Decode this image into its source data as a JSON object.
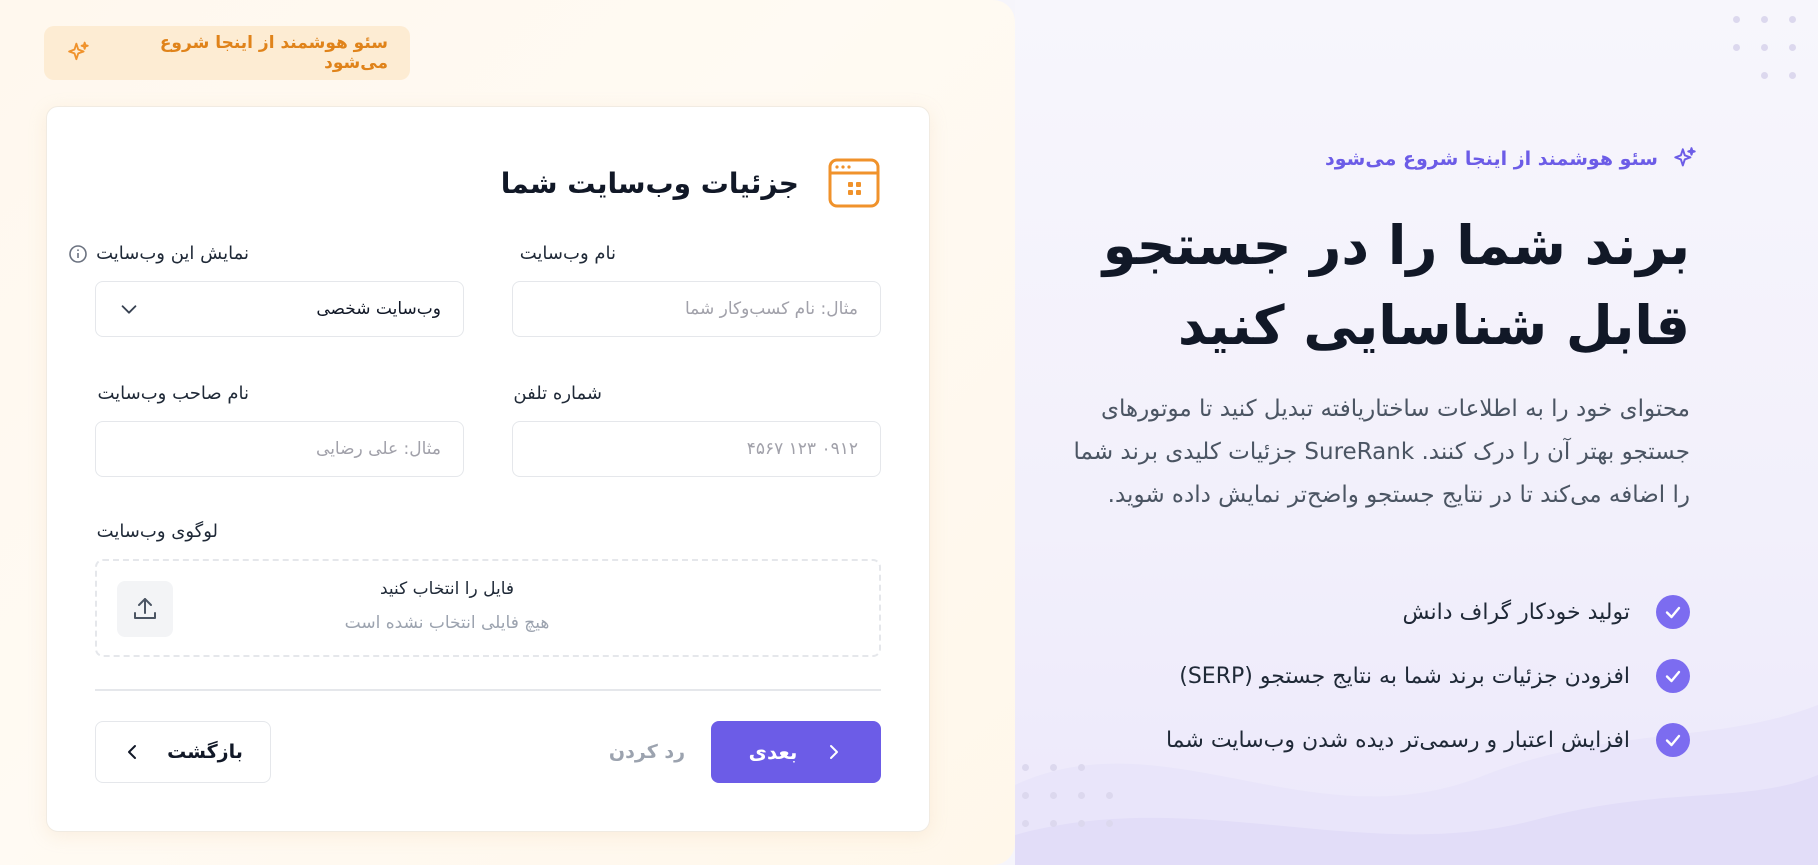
{
  "top_badge": {
    "text": "سئو هوشمند از اینجا شروع می‌شود",
    "icon": "sparkle-icon"
  },
  "card": {
    "title": "جزئیات وب‌سایت شما",
    "fields": {
      "website_name": {
        "label": "نام وب‌سایت",
        "placeholder": "مثال: نام کسب‌وکار شما"
      },
      "website_type": {
        "label": "نمایش این وب‌سایت",
        "value": "وب‌سایت شخصی"
      },
      "phone": {
        "label": "شماره تلفن",
        "placeholder": "۰۹۱۲ ۱۲۳ ۴۵۶۷"
      },
      "owner_name": {
        "label": "نام صاحب وب‌سایت",
        "placeholder": "مثال: علی رضایی"
      },
      "logo": {
        "label": "لوگوی وب‌سایت",
        "choose_text": "فایل را انتخاب کنید",
        "no_file_text": "هیچ فایلی انتخاب نشده است"
      }
    },
    "buttons": {
      "back": "بازگشت",
      "skip": "رد کردن",
      "next": "بعدی"
    }
  },
  "hero": {
    "badge": "سئو هوشمند از اینجا شروع می‌شود",
    "title_line1": "برند شما را در جستجو",
    "title_line2": "قابل شناسایی کنید",
    "description": "محتوای خود را به اطلاعات ساختاریافته تبدیل کنید تا موتورهای جستجو بهتر آن را درک کنند. SureRank جزئیات کلیدی برند شما را اضافه می‌کند تا در نتایج جستجو واضح‌تر نمایش داده شوید.",
    "features": [
      "تولید خودکار گراف دانش",
      "افزودن جزئیات برند شما به نتایج جستجو (SERP)",
      "افزایش اعتبار و رسمی‌تر دیده شدن وب‌سایت شما"
    ]
  },
  "colors": {
    "accent": "#6c5ce7",
    "orange": "#f0922b",
    "badge_bg": "#fdecd3"
  }
}
